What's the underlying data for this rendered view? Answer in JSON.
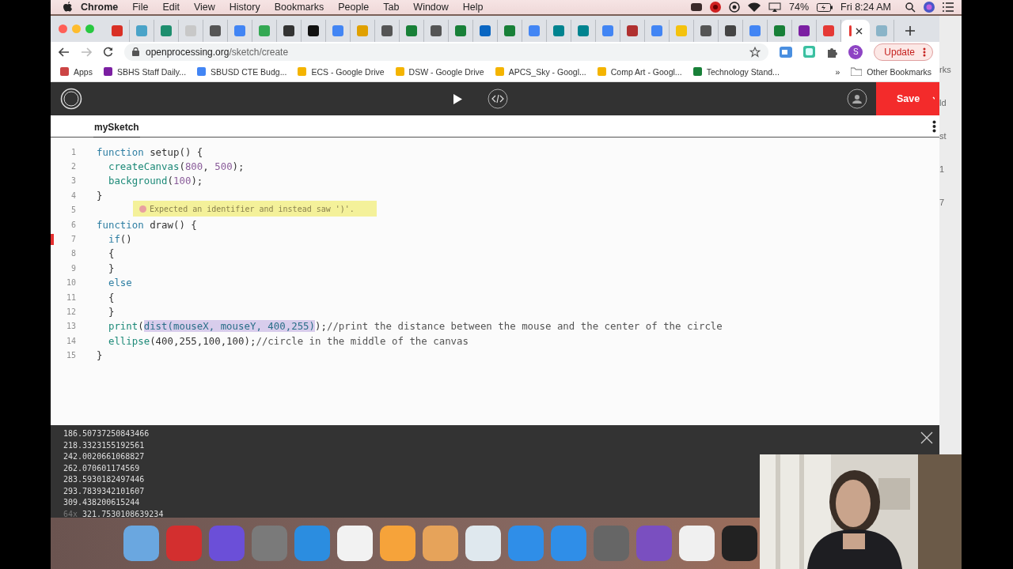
{
  "menu_bar": {
    "app": "Chrome",
    "items": [
      "File",
      "Edit",
      "View",
      "History",
      "Bookmarks",
      "People",
      "Tab",
      "Window",
      "Help"
    ],
    "battery": "74%",
    "clock": "Fri 8:24 AM"
  },
  "browser_tabs": [
    {
      "selected": false
    },
    {
      "selected": false
    },
    {
      "selected": false
    },
    {
      "selected": false
    },
    {
      "selected": false
    },
    {
      "selected": false
    },
    {
      "selected": false
    },
    {
      "selected": false
    },
    {
      "selected": false
    },
    {
      "selected": false
    },
    {
      "selected": false
    },
    {
      "selected": false
    },
    {
      "selected": false
    },
    {
      "selected": false
    },
    {
      "selected": false
    },
    {
      "selected": false
    },
    {
      "selected": false
    },
    {
      "selected": false
    },
    {
      "selected": false
    },
    {
      "selected": false
    },
    {
      "selected": false
    },
    {
      "selected": false
    },
    {
      "selected": false
    },
    {
      "selected": false
    },
    {
      "selected": false
    },
    {
      "selected": false
    },
    {
      "selected": false
    },
    {
      "selected": false
    },
    {
      "selected": false
    },
    {
      "selected": false
    },
    {
      "selected": true
    },
    {
      "selected": false
    }
  ],
  "address": {
    "host": "openprocessing.org",
    "path": "/sketch/create"
  },
  "profile_initial": "S",
  "update_button": "Update",
  "bookmarks": [
    "Apps",
    "SBHS Staff Daily...",
    "SBUSD CTE Budg...",
    "ECS - Google Drive",
    "DSW - Google Drive",
    "APCS_Sky - Googl...",
    "Comp Art - Googl...",
    "Technology Stand..."
  ],
  "bookmarks_more": "»",
  "other_bookmarks": "Other Bookmarks",
  "app_bar": {
    "save": "Save"
  },
  "sketch_tab": "mySketch",
  "code_lines": [
    {
      "number": "1",
      "error": false,
      "tokens": [
        {
          "text": "function",
          "kind": "kw"
        },
        {
          "text": " setup() {",
          "kind": "plain"
        }
      ]
    },
    {
      "number": "2",
      "error": false,
      "tokens": [
        {
          "text": "  createCanvas",
          "kind": "fn"
        },
        {
          "text": "(",
          "kind": "plain"
        },
        {
          "text": "800",
          "kind": "num"
        },
        {
          "text": ", ",
          "kind": "plain"
        },
        {
          "text": "500",
          "kind": "num"
        },
        {
          "text": ");",
          "kind": "plain"
        }
      ]
    },
    {
      "number": "3",
      "error": false,
      "tokens": [
        {
          "text": "  background",
          "kind": "fn"
        },
        {
          "text": "(",
          "kind": "plain"
        },
        {
          "text": "100",
          "kind": "num"
        },
        {
          "text": ");",
          "kind": "plain"
        }
      ]
    },
    {
      "number": "4",
      "error": false,
      "tokens": [
        {
          "text": "}",
          "kind": "plain"
        }
      ]
    },
    {
      "number": "5",
      "error": false
    },
    {
      "number": "6",
      "error": false,
      "tokens": [
        {
          "text": "function",
          "kind": "kw"
        },
        {
          "text": " draw() {",
          "kind": "plain"
        }
      ]
    },
    {
      "number": "7",
      "error": true,
      "tokens": [
        {
          "text": "  if",
          "kind": "kw"
        },
        {
          "text": "()",
          "kind": "plain"
        }
      ]
    },
    {
      "number": "8",
      "error": false,
      "tokens": [
        {
          "text": "  {",
          "kind": "plain"
        }
      ]
    },
    {
      "number": "9",
      "error": false,
      "tokens": [
        {
          "text": "  }",
          "kind": "plain"
        }
      ]
    },
    {
      "number": "10",
      "error": false,
      "tokens": [
        {
          "text": "  else",
          "kind": "kw"
        }
      ]
    },
    {
      "number": "11",
      "error": false,
      "tokens": [
        {
          "text": "  {",
          "kind": "plain"
        }
      ]
    },
    {
      "number": "12",
      "error": false,
      "tokens": [
        {
          "text": "  }",
          "kind": "plain"
        }
      ]
    },
    {
      "number": "13",
      "error": false,
      "tokens": [
        {
          "text": "  print",
          "kind": "fn"
        },
        {
          "text": "(",
          "kind": "plain"
        },
        {
          "text": "dist(mouseX, mouseY, 400,255)",
          "kind": "sel"
        },
        {
          "text": ");",
          "kind": "plain"
        },
        {
          "text": "//print the distance between the mouse and the center of the circle",
          "kind": "comment"
        }
      ]
    },
    {
      "number": "14",
      "error": false,
      "tokens": [
        {
          "text": "  ellipse",
          "kind": "fn"
        },
        {
          "text": "(400,255,100,100);",
          "kind": "plain"
        },
        {
          "text": "//circle in the middle of the canvas",
          "kind": "comment"
        }
      ]
    },
    {
      "number": "15",
      "error": false,
      "tokens": [
        {
          "text": "}",
          "kind": "plain"
        }
      ]
    }
  ],
  "error_tooltip": "Expected an identifier and instead saw ')'.",
  "console": {
    "lines": [
      "186.50737250843466",
      "218.3323155192561",
      "242.0020661068827",
      "262.070601174569",
      "283.5930182497446",
      "293.7839342101607",
      "309.438200615244",
      "321.7530108639234"
    ],
    "repeat_count": "64x"
  },
  "background_window": [
    "rks",
    "ld",
    "st",
    "1",
    "7"
  ]
}
